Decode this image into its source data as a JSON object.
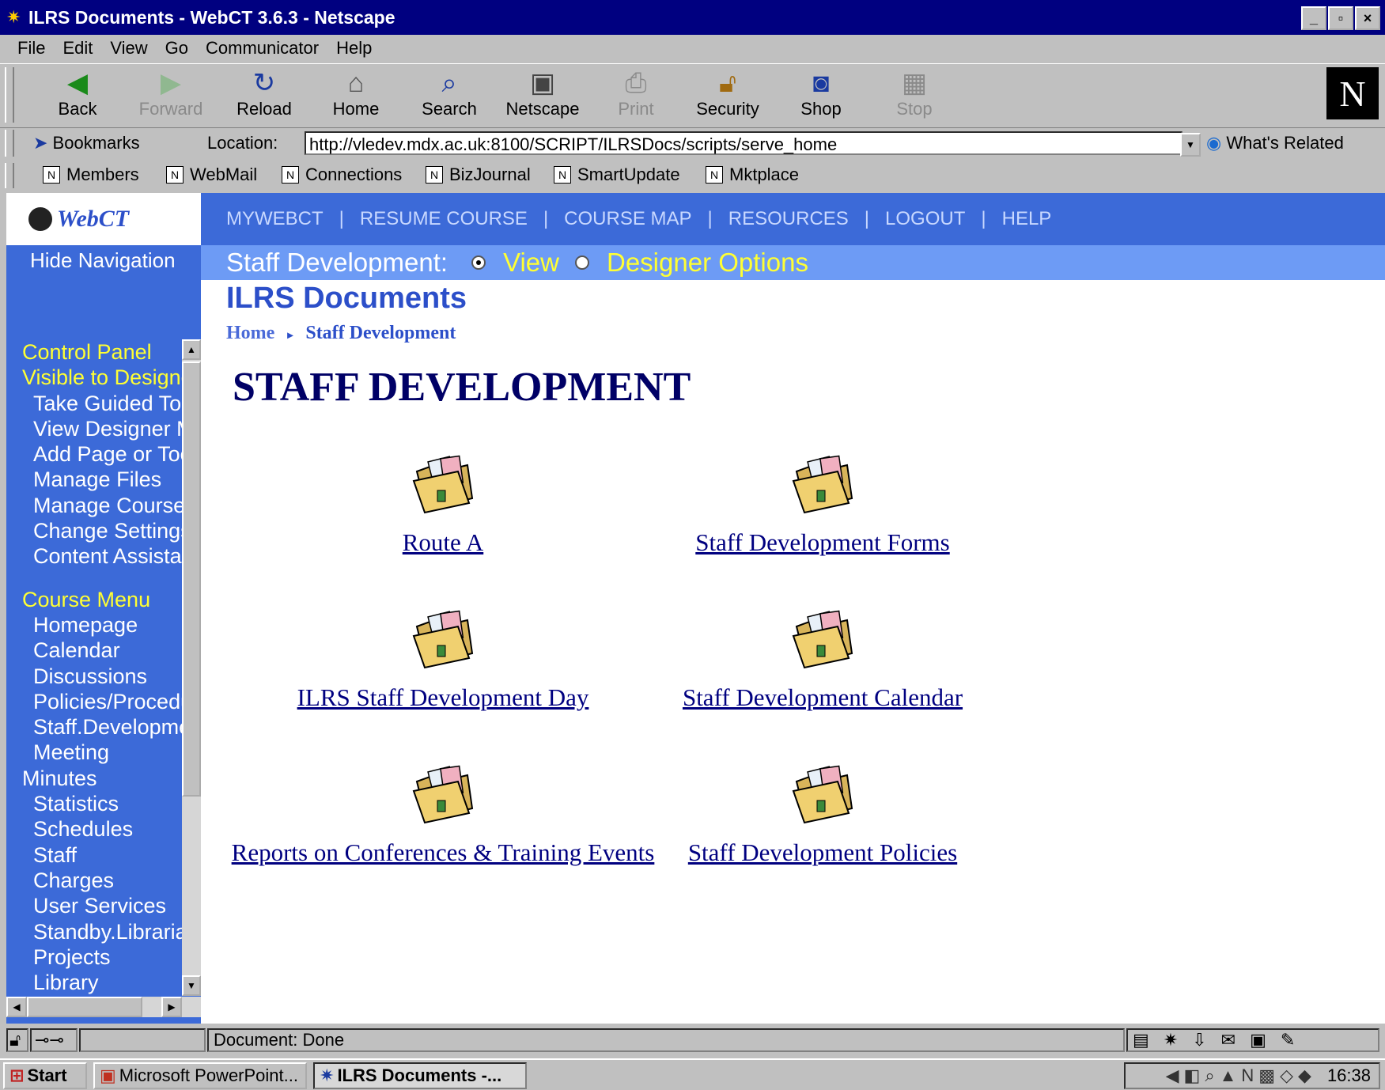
{
  "window": {
    "title": "ILRS Documents - WebCT 3.6.3 - Netscape",
    "controls": [
      "_",
      "▫",
      "×"
    ]
  },
  "menu": [
    "File",
    "Edit",
    "View",
    "Go",
    "Communicator",
    "Help"
  ],
  "toolbar": {
    "back": "Back",
    "forward": "Forward",
    "reload": "Reload",
    "home": "Home",
    "search": "Search",
    "netscape": "Netscape",
    "print": "Print",
    "security": "Security",
    "shop": "Shop",
    "stop": "Stop",
    "logo": "N"
  },
  "location": {
    "bookmarks": "Bookmarks",
    "label": "Location:",
    "url": "http://vledev.mdx.ac.uk:8100/SCRIPT/ILRSDocs/scripts/serve_home",
    "related": "What's Related"
  },
  "personal_toolbar": [
    "Members",
    "WebMail",
    "Connections",
    "BizJournal",
    "SmartUpdate",
    "Mktplace"
  ],
  "webct": {
    "logo": "WebCT",
    "topnav": [
      "MYWEBCT",
      "RESUME COURSE",
      "COURSE MAP",
      "RESOURCES",
      "LOGOUT",
      "HELP"
    ],
    "section": "Staff Development:",
    "view_label": "View",
    "designer_label": "Designer Options",
    "hide_nav": "Hide Navigation",
    "page_title": "ILRS Documents",
    "breadcrumb": [
      "Home",
      "Staff Development"
    ],
    "heading": "STAFF DEVELOPMENT",
    "items": [
      "Route A",
      "Staff Development Forms",
      "ILRS Staff Development Day",
      "Staff Development Calendar",
      "Reports on Conferences & Training Events",
      "Staff Development Policies"
    ]
  },
  "sidebar": {
    "control_panel": {
      "header": "Control Panel",
      "sub": "Visible to Designer",
      "items": [
        "Take Guided Tour",
        "View Designer Map",
        "Add Page or Tool",
        "Manage Files",
        "Manage Course",
        "Change Settings",
        "Content Assistant"
      ]
    },
    "course_menu": {
      "header": "Course Menu",
      "items": [
        "Homepage",
        "Calendar",
        "Discussions",
        "Policies/Procedures",
        "Staff.Development",
        "Meeting"
      ],
      "flush": "Minutes",
      "items2": [
        "Statistics",
        "Schedules",
        "Staff",
        "Charges",
        "User Services",
        "Standby.Librarians",
        "Projects",
        "Library"
      ]
    }
  },
  "status": {
    "text": "Document: Done"
  },
  "taskbar": {
    "start": "Start",
    "tasks": [
      "Microsoft PowerPoint...",
      "ILRS Documents -..."
    ],
    "clock": "16:38"
  }
}
